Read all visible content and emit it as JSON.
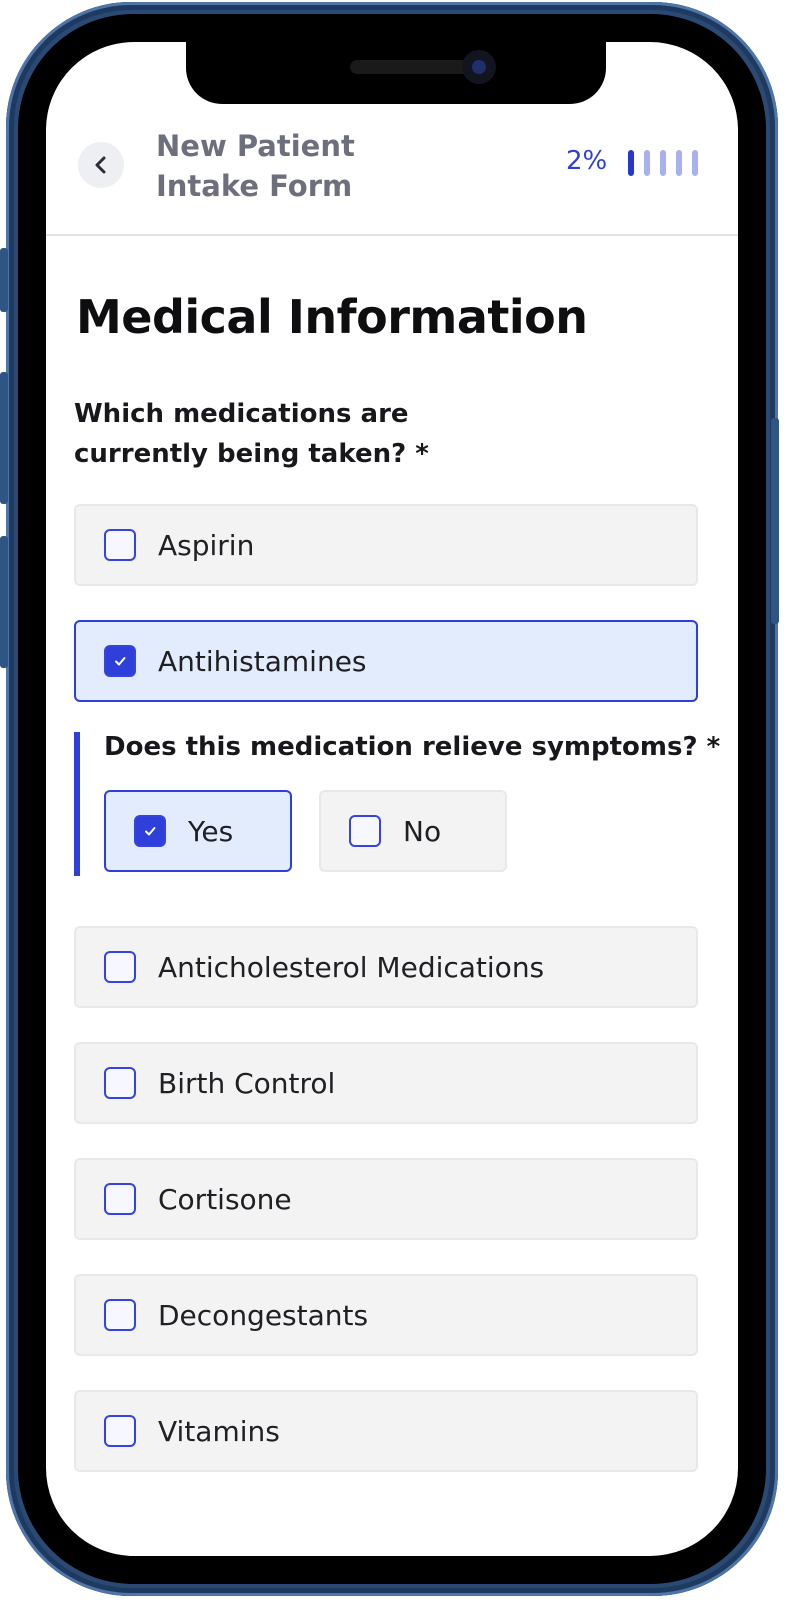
{
  "header": {
    "back_label": "Back",
    "form_title": "New Patient Intake Form",
    "progress_text": "2%",
    "progress_percent": 2,
    "progress_steps_total": 5,
    "progress_steps_complete": 1
  },
  "section": {
    "title": "Medical Information"
  },
  "question": {
    "text": "Which medications are currently being taken? *"
  },
  "options": [
    {
      "label": "Aspirin",
      "checked": false
    },
    {
      "label": "Antihistamines",
      "checked": true
    },
    {
      "label": "Anticholesterol Medications",
      "checked": false
    },
    {
      "label": "Birth Control",
      "checked": false
    },
    {
      "label": "Cortisone",
      "checked": false
    },
    {
      "label": "Decongestants",
      "checked": false
    },
    {
      "label": "Vitamins",
      "checked": false
    }
  ],
  "followup": {
    "question": "Does this medication relieve symptoms? *",
    "yes_label": "Yes",
    "yes_checked": true,
    "no_label": "No",
    "no_checked": false
  },
  "colors": {
    "accent": "#2f3fd9",
    "selected_bg": "#e3ecfd",
    "option_bg": "#f3f3f4",
    "frame": "#2a4a74"
  }
}
